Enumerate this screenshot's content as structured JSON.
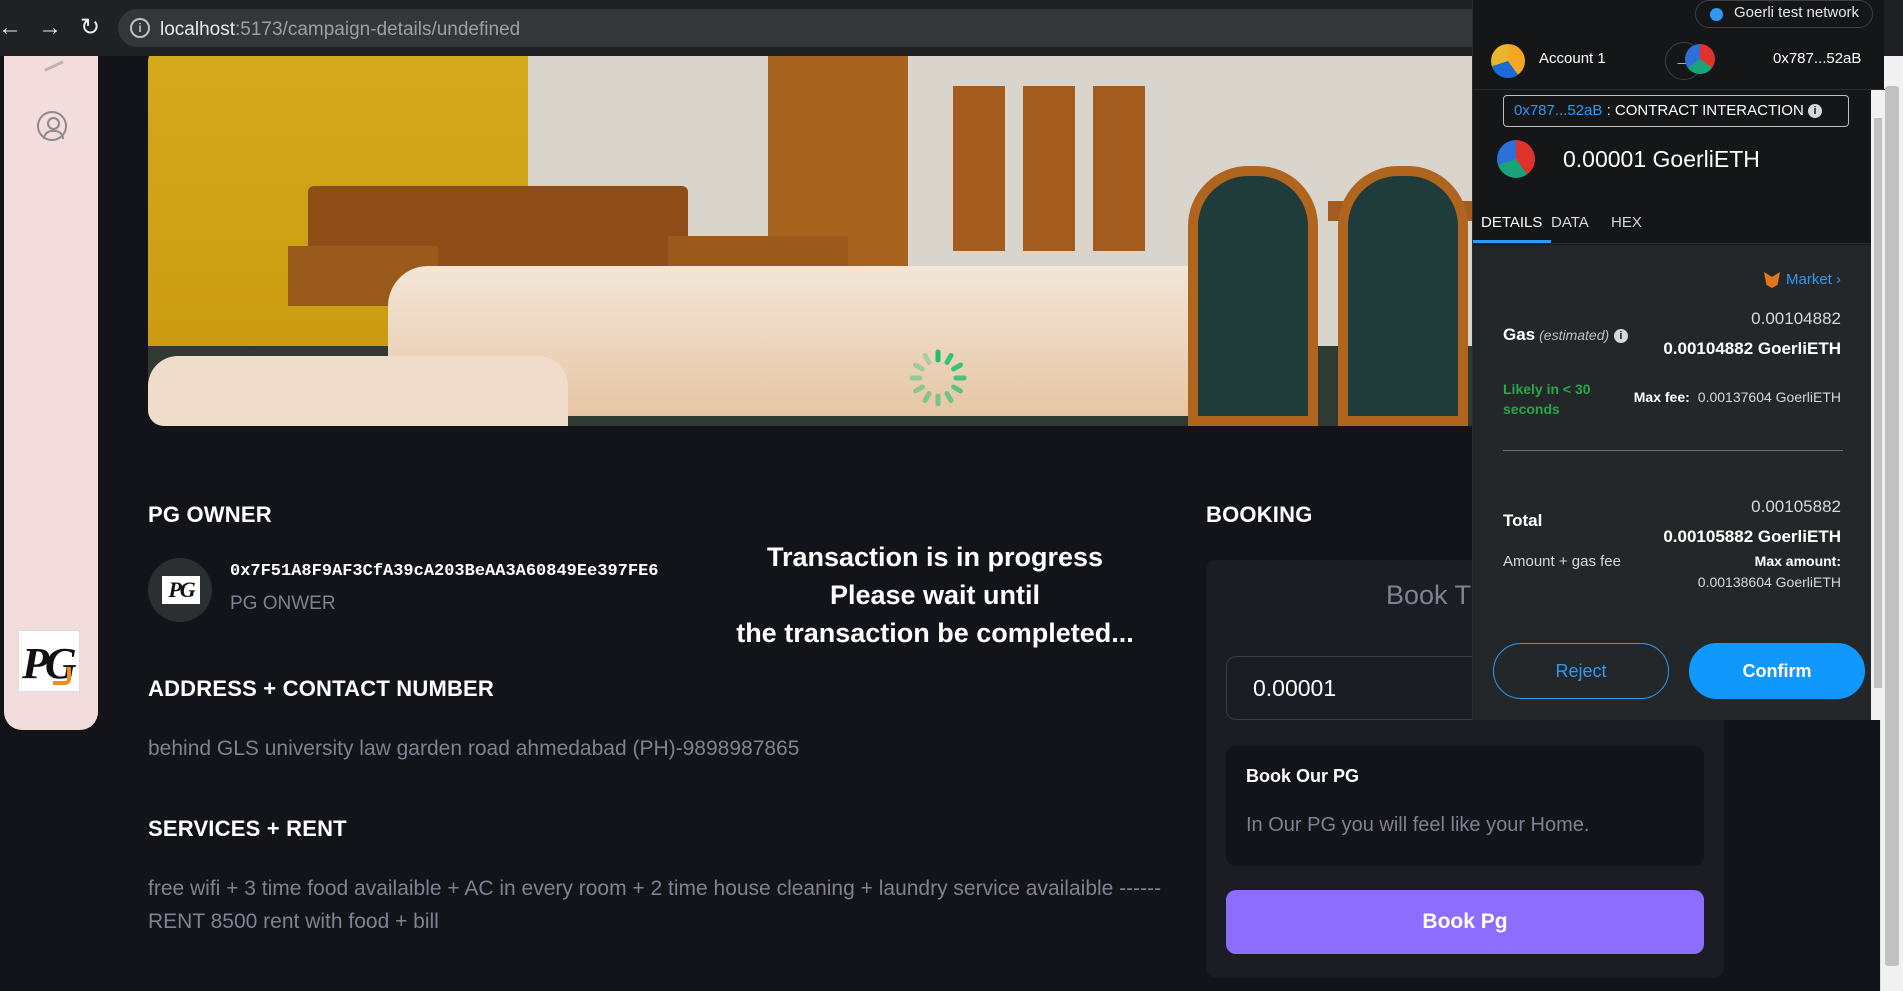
{
  "browser": {
    "url_host": "localhost",
    "url_path": ":5173/campaign-details/undefined"
  },
  "logo_text": "PG",
  "owner": {
    "section_title": "PG OWNER",
    "address": "0x7F51A8F9AF3CfA39cA203BeAA3A60849Ee397FE6",
    "label": "PG ONWER"
  },
  "address_section": {
    "title": "ADDRESS + CONTACT NUMBER",
    "text": "behind GLS university law garden road ahmedabad (PH)-9898987865"
  },
  "services_section": {
    "title": "SERVICES + RENT",
    "text": "free wifi + 3 time food availaible + AC in every room + 2 time house cleaning + laundry service availaible ------RENT 8500 rent with food + bill"
  },
  "overlay": {
    "line1": "Transaction is in progress",
    "line2": "Please wait until",
    "line3": "the transaction be completed..."
  },
  "booking": {
    "section_title": "BOOKING",
    "box_title": "Book Th",
    "amount_value": "0.00001",
    "card_title": "Book Our PG",
    "card_text": "In Our PG you will feel like your Home.",
    "button_label": "Book Pg"
  },
  "metamask": {
    "network": "Goerli test network",
    "from_account": "Account 1",
    "to_address": "0x787...52aB",
    "contract_address": "0x787...52aB",
    "contract_label": ": CONTRACT INTERACTION",
    "value": "0.00001 GoerliETH",
    "tabs": [
      "DETAILS",
      "DATA",
      "HEX"
    ],
    "market_label": "Market",
    "gas_label": "Gas",
    "gas_estimated": "(estimated)",
    "gas_small": "0.00104882",
    "gas_big": "0.00104882 GoerliETH",
    "likely": "Likely in < 30 seconds",
    "max_fee_label": "Max fee:",
    "max_fee_value": "0.00137604 GoerliETH",
    "total_label": "Total",
    "total_small": "0.00105882",
    "total_big": "0.00105882 GoerliETH",
    "amount_gas_label": "Amount + gas fee",
    "max_amount_label": "Max amount:",
    "max_amount_value": "0.00138604 GoerliETH",
    "reject_label": "Reject",
    "confirm_label": "Confirm",
    "accent_color": "#3099f2"
  }
}
